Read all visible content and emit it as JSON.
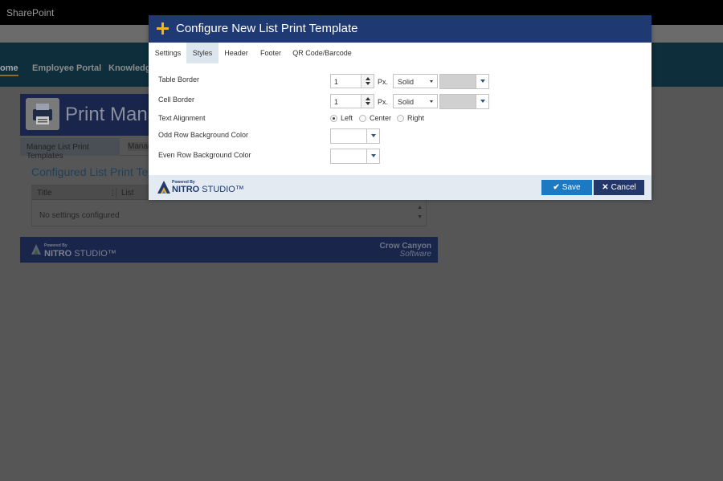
{
  "app": {
    "title": "SharePoint"
  },
  "nav": {
    "items": [
      {
        "label": "ome",
        "active": true
      },
      {
        "label": "Employee Portal",
        "active": false
      },
      {
        "label": "Knowledge",
        "active": false
      }
    ]
  },
  "page": {
    "header_title": "Print Manag",
    "tabs": [
      "Manage List Print Templates",
      "Manag"
    ],
    "section_title": "Configured List Print Tem",
    "grid": {
      "columns": [
        "Title",
        "List"
      ],
      "empty_text": "No settings configured"
    },
    "footer": {
      "powered_by": "Powered By",
      "brand_bold": "NITRO",
      "brand_light": "STUDIO™",
      "company_line1": "Crow Canyon",
      "company_line2": "Software"
    }
  },
  "modal": {
    "title": "Configure New List Print Template",
    "tabs": [
      {
        "label": "Settings",
        "active": false
      },
      {
        "label": "Styles",
        "active": true
      },
      {
        "label": "Header",
        "active": false
      },
      {
        "label": "Footer",
        "active": false
      },
      {
        "label": "QR Code/Barcode",
        "active": false
      }
    ],
    "fields": {
      "table_border": {
        "label": "Table Border",
        "value": "1",
        "unit": "Px.",
        "style": "Solid",
        "color": "#d0d0d0"
      },
      "cell_border": {
        "label": "Cell Border",
        "value": "1",
        "unit": "Px.",
        "style": "Solid",
        "color": "#d0d0d0"
      },
      "text_alignment": {
        "label": "Text Alignment",
        "options": [
          "Left",
          "Center",
          "Right"
        ],
        "selected": "Left"
      },
      "odd_row_bg": {
        "label": "Odd Row Background Color",
        "color": "#ffffff"
      },
      "even_row_bg": {
        "label": "Even Row Background Color",
        "color": "#ffffff"
      }
    },
    "footer": {
      "powered_by": "Powered By",
      "brand_bold": "NITRO",
      "brand_light": "STUDIO™",
      "save_label": "Save",
      "cancel_label": "Cancel"
    }
  },
  "colors": {
    "modal_header": "#1f3a73",
    "accent_plus": "#f5b120",
    "save_button": "#1d79c2",
    "cancel_button": "#24376b",
    "active_tab": "#dde6ef"
  }
}
